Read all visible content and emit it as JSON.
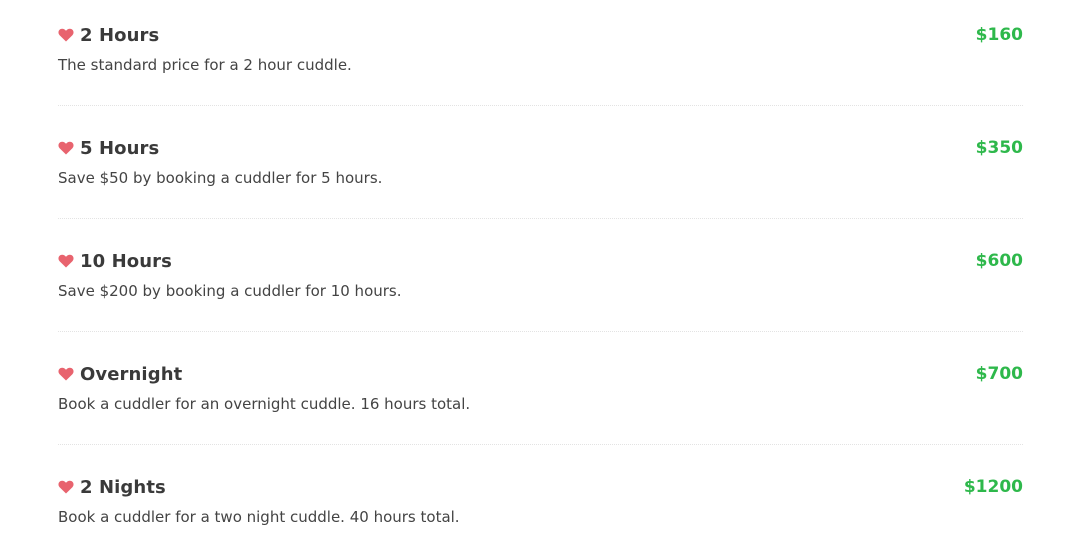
{
  "colors": {
    "heart": "#e8636e",
    "price": "#2eb84b",
    "title": "#3a3a3a",
    "description": "#444444"
  },
  "items": [
    {
      "icon": "heart-icon",
      "title": "2 Hours",
      "description": "The standard price for a 2 hour cuddle.",
      "price": "$160"
    },
    {
      "icon": "heart-icon",
      "title": "5 Hours",
      "description": "Save $50 by booking a cuddler for 5 hours.",
      "price": "$350"
    },
    {
      "icon": "heart-icon",
      "title": "10 Hours",
      "description": "Save $200 by booking a cuddler for 10 hours.",
      "price": "$600"
    },
    {
      "icon": "heart-icon",
      "title": "Overnight",
      "description": "Book a cuddler for an overnight cuddle. 16 hours total.",
      "price": "$700"
    },
    {
      "icon": "heart-icon",
      "title": "2 Nights",
      "description": "Book a cuddler for a two night cuddle. 40 hours total.",
      "price": "$1200"
    }
  ]
}
